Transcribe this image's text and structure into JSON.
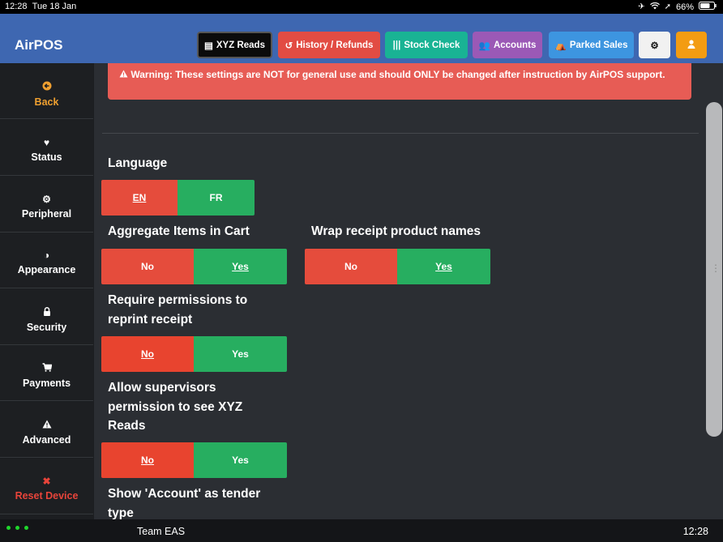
{
  "status_bar": {
    "time": "12:28",
    "date": "Tue 18 Jan",
    "battery": "66%"
  },
  "app": {
    "title": "AirPOS"
  },
  "nav": {
    "xyz_reads": "XYZ Reads",
    "history": "History / Refunds",
    "stock_check": "Stock Check",
    "accounts": "Accounts",
    "parked_sales": "Parked Sales"
  },
  "sidebar": {
    "items": [
      {
        "label": "Back",
        "icon": "back-arrow-icon"
      },
      {
        "label": "Status",
        "icon": "heartbeat-icon"
      },
      {
        "label": "Peripheral",
        "icon": "gear-icon"
      },
      {
        "label": "Appearance",
        "icon": "contrast-icon"
      },
      {
        "label": "Security",
        "icon": "lock-icon"
      },
      {
        "label": "Payments",
        "icon": "cart-icon"
      },
      {
        "label": "Advanced",
        "icon": "warning-icon"
      },
      {
        "label": "Reset Device",
        "icon": "close-icon"
      }
    ]
  },
  "warning": {
    "text": "Warning: These settings are NOT for general use and should ONLY be changed after instruction by AirPOS support."
  },
  "settings": {
    "language": {
      "label": "Language",
      "opt1": "EN",
      "opt2": "FR",
      "selected": "EN"
    },
    "aggregate": {
      "label": "Aggregate Items in Cart",
      "opt1": "No",
      "opt2": "Yes",
      "selected": "Yes"
    },
    "wrap": {
      "label": "Wrap receipt product names",
      "opt1": "No",
      "opt2": "Yes",
      "selected": "Yes"
    },
    "reprint": {
      "label_1": "Require permissions to",
      "label_2": "reprint receipt",
      "opt1": "No",
      "opt2": "Yes",
      "selected": "No"
    },
    "supervisors": {
      "label_1": "Allow supervisors",
      "label_2": "permission to see XYZ",
      "label_3": "Reads",
      "opt1": "No",
      "opt2": "Yes",
      "selected": "No"
    },
    "account_tender": {
      "label_1": "Show 'Account' as tender",
      "label_2": "type"
    }
  },
  "bottom_bar": {
    "team": "Team EAS",
    "time": "12:28"
  },
  "colors": {
    "navbar": "#3e67b1",
    "red": "#e54c3c",
    "green": "#27ae60",
    "orange": "#f39c12"
  }
}
